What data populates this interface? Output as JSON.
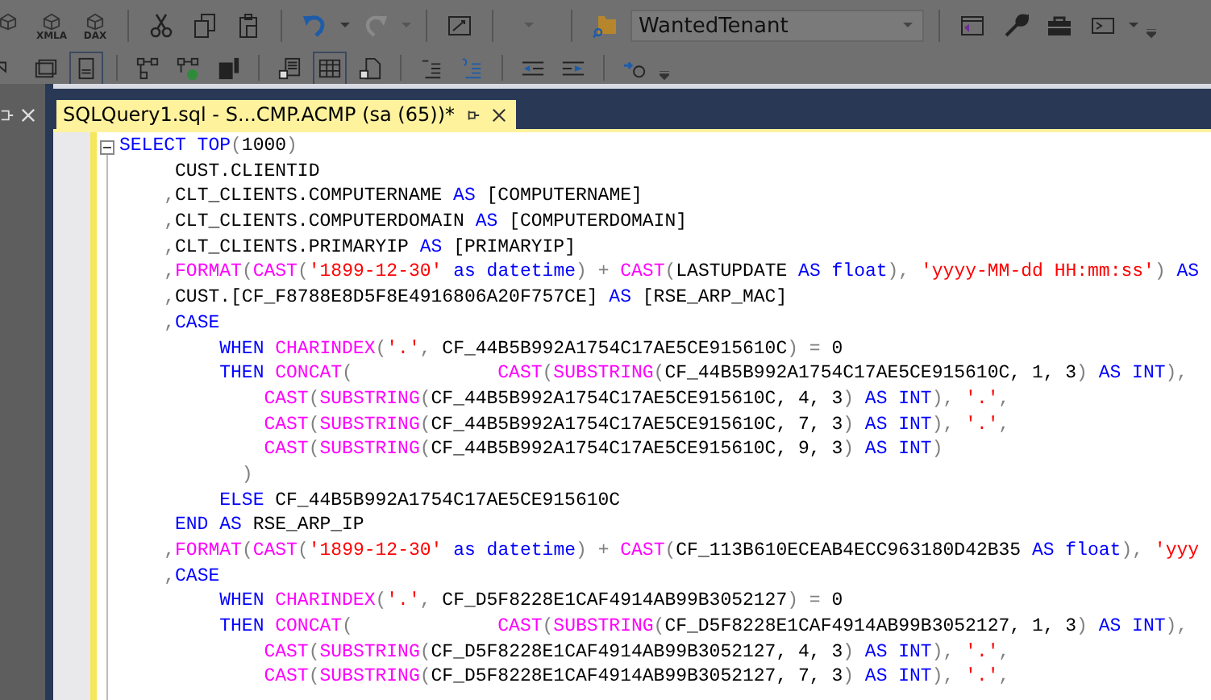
{
  "toolbar": {
    "icon_labels": [
      "XMLA",
      "DAX"
    ],
    "database_combo": {
      "value": "WantedTenant"
    }
  },
  "document_tab": {
    "title": "SQLQuery1.sql - S...CMP.ACMP (sa (65))*",
    "selected": true
  },
  "code_lines": [
    [
      {
        "kind": "kw",
        "text": "SELECT TOP"
      },
      {
        "kind": "op",
        "text": "("
      },
      {
        "kind": "txt",
        "text": "1000"
      },
      {
        "kind": "op",
        "text": ")"
      }
    ],
    [
      {
        "kind": "txt",
        "text": "     CUST.CLIENTID"
      }
    ],
    [
      {
        "kind": "op",
        "text": "    ,"
      },
      {
        "kind": "txt",
        "text": "CLT_CLIENTS.COMPUTERNAME"
      },
      {
        "kind": "kw",
        "text": " AS"
      },
      {
        "kind": "txt",
        "text": " [COMPUTERNAME]"
      }
    ],
    [
      {
        "kind": "op",
        "text": "    ,"
      },
      {
        "kind": "txt",
        "text": "CLT_CLIENTS.COMPUTERDOMAIN"
      },
      {
        "kind": "kw",
        "text": " AS"
      },
      {
        "kind": "txt",
        "text": " [COMPUTERDOMAIN]"
      }
    ],
    [
      {
        "kind": "op",
        "text": "    ,"
      },
      {
        "kind": "txt",
        "text": "CLT_CLIENTS.PRIMARYIP"
      },
      {
        "kind": "kw",
        "text": " AS"
      },
      {
        "kind": "txt",
        "text": " [PRIMARYIP]"
      }
    ],
    [
      {
        "kind": "op",
        "text": "    ,"
      },
      {
        "kind": "fn",
        "text": "FORMAT"
      },
      {
        "kind": "op",
        "text": "("
      },
      {
        "kind": "fn",
        "text": "CAST"
      },
      {
        "kind": "op",
        "text": "("
      },
      {
        "kind": "str",
        "text": "'1899-12-30'"
      },
      {
        "kind": "kw",
        "text": " as datetime"
      },
      {
        "kind": "op",
        "text": ") + "
      },
      {
        "kind": "fn",
        "text": "CAST"
      },
      {
        "kind": "op",
        "text": "("
      },
      {
        "kind": "txt",
        "text": "LASTUPDATE"
      },
      {
        "kind": "kw",
        "text": " AS float"
      },
      {
        "kind": "op",
        "text": "), "
      },
      {
        "kind": "str",
        "text": "'yyyy-MM-dd HH:mm:ss'"
      },
      {
        "kind": "op",
        "text": ")"
      },
      {
        "kind": "kw",
        "text": " AS"
      }
    ],
    [
      {
        "kind": "op",
        "text": "    ,"
      },
      {
        "kind": "txt",
        "text": "CUST.[CF_F8788E8D5F8E4916806A20F757CE]"
      },
      {
        "kind": "kw",
        "text": " AS"
      },
      {
        "kind": "txt",
        "text": " [RSE_ARP_MAC]"
      }
    ],
    [
      {
        "kind": "op",
        "text": "    ,"
      },
      {
        "kind": "kw",
        "text": "CASE"
      }
    ],
    [
      {
        "kind": "kw",
        "text": "         WHEN"
      },
      {
        "kind": "fn",
        "text": " CHARINDEX"
      },
      {
        "kind": "op",
        "text": "("
      },
      {
        "kind": "str",
        "text": "'.'"
      },
      {
        "kind": "op",
        "text": ", "
      },
      {
        "kind": "txt",
        "text": "CF_44B5B992A1754C17AE5CE915610C"
      },
      {
        "kind": "op",
        "text": ") = "
      },
      {
        "kind": "txt",
        "text": "0"
      }
    ],
    [
      {
        "kind": "kw",
        "text": "         THEN"
      },
      {
        "kind": "fn",
        "text": " CONCAT"
      },
      {
        "kind": "op",
        "text": "(             "
      },
      {
        "kind": "fn",
        "text": "CAST"
      },
      {
        "kind": "op",
        "text": "("
      },
      {
        "kind": "fn",
        "text": "SUBSTRING"
      },
      {
        "kind": "op",
        "text": "("
      },
      {
        "kind": "txt",
        "text": "CF_44B5B992A1754C17AE5CE915610C, 1, 3"
      },
      {
        "kind": "op",
        "text": ")"
      },
      {
        "kind": "kw",
        "text": " AS INT"
      },
      {
        "kind": "op",
        "text": "),"
      }
    ],
    [
      {
        "kind": "fn",
        "text": "             CAST"
      },
      {
        "kind": "op",
        "text": "("
      },
      {
        "kind": "fn",
        "text": "SUBSTRING"
      },
      {
        "kind": "op",
        "text": "("
      },
      {
        "kind": "txt",
        "text": "CF_44B5B992A1754C17AE5CE915610C, 4, 3"
      },
      {
        "kind": "op",
        "text": ")"
      },
      {
        "kind": "kw",
        "text": " AS INT"
      },
      {
        "kind": "op",
        "text": "), "
      },
      {
        "kind": "str",
        "text": "'.'"
      },
      {
        "kind": "op",
        "text": ","
      }
    ],
    [
      {
        "kind": "fn",
        "text": "             CAST"
      },
      {
        "kind": "op",
        "text": "("
      },
      {
        "kind": "fn",
        "text": "SUBSTRING"
      },
      {
        "kind": "op",
        "text": "("
      },
      {
        "kind": "txt",
        "text": "CF_44B5B992A1754C17AE5CE915610C, 7, 3"
      },
      {
        "kind": "op",
        "text": ")"
      },
      {
        "kind": "kw",
        "text": " AS INT"
      },
      {
        "kind": "op",
        "text": "), "
      },
      {
        "kind": "str",
        "text": "'.'"
      },
      {
        "kind": "op",
        "text": ","
      }
    ],
    [
      {
        "kind": "fn",
        "text": "             CAST"
      },
      {
        "kind": "op",
        "text": "("
      },
      {
        "kind": "fn",
        "text": "SUBSTRING"
      },
      {
        "kind": "op",
        "text": "("
      },
      {
        "kind": "txt",
        "text": "CF_44B5B992A1754C17AE5CE915610C, 9, 3"
      },
      {
        "kind": "op",
        "text": ")"
      },
      {
        "kind": "kw",
        "text": " AS INT"
      },
      {
        "kind": "op",
        "text": ")"
      }
    ],
    [
      {
        "kind": "op",
        "text": "           )"
      }
    ],
    [
      {
        "kind": "kw",
        "text": "         ELSE"
      },
      {
        "kind": "txt",
        "text": " CF_44B5B992A1754C17AE5CE915610C"
      }
    ],
    [
      {
        "kind": "kw",
        "text": "     END AS"
      },
      {
        "kind": "txt",
        "text": " RSE_ARP_IP"
      }
    ],
    [
      {
        "kind": "op",
        "text": "    ,"
      },
      {
        "kind": "fn",
        "text": "FORMAT"
      },
      {
        "kind": "op",
        "text": "("
      },
      {
        "kind": "fn",
        "text": "CAST"
      },
      {
        "kind": "op",
        "text": "("
      },
      {
        "kind": "str",
        "text": "'1899-12-30'"
      },
      {
        "kind": "kw",
        "text": " as datetime"
      },
      {
        "kind": "op",
        "text": ") + "
      },
      {
        "kind": "fn",
        "text": "CAST"
      },
      {
        "kind": "op",
        "text": "("
      },
      {
        "kind": "txt",
        "text": "CF_113B610ECEAB4ECC963180D42B35"
      },
      {
        "kind": "kw",
        "text": " AS float"
      },
      {
        "kind": "op",
        "text": "), "
      },
      {
        "kind": "str",
        "text": "'yyy"
      }
    ],
    [
      {
        "kind": "op",
        "text": "    ,"
      },
      {
        "kind": "kw",
        "text": "CASE"
      }
    ],
    [
      {
        "kind": "kw",
        "text": "         WHEN"
      },
      {
        "kind": "fn",
        "text": " CHARINDEX"
      },
      {
        "kind": "op",
        "text": "("
      },
      {
        "kind": "str",
        "text": "'.'"
      },
      {
        "kind": "op",
        "text": ", "
      },
      {
        "kind": "txt",
        "text": "CF_D5F8228E1CAF4914AB99B3052127"
      },
      {
        "kind": "op",
        "text": ") = "
      },
      {
        "kind": "txt",
        "text": "0"
      }
    ],
    [
      {
        "kind": "kw",
        "text": "         THEN"
      },
      {
        "kind": "fn",
        "text": " CONCAT"
      },
      {
        "kind": "op",
        "text": "(             "
      },
      {
        "kind": "fn",
        "text": "CAST"
      },
      {
        "kind": "op",
        "text": "("
      },
      {
        "kind": "fn",
        "text": "SUBSTRING"
      },
      {
        "kind": "op",
        "text": "("
      },
      {
        "kind": "txt",
        "text": "CF_D5F8228E1CAF4914AB99B3052127, 1, 3"
      },
      {
        "kind": "op",
        "text": ")"
      },
      {
        "kind": "kw",
        "text": " AS INT"
      },
      {
        "kind": "op",
        "text": "),"
      }
    ],
    [
      {
        "kind": "fn",
        "text": "             CAST"
      },
      {
        "kind": "op",
        "text": "("
      },
      {
        "kind": "fn",
        "text": "SUBSTRING"
      },
      {
        "kind": "op",
        "text": "("
      },
      {
        "kind": "txt",
        "text": "CF_D5F8228E1CAF4914AB99B3052127, 4, 3"
      },
      {
        "kind": "op",
        "text": ")"
      },
      {
        "kind": "kw",
        "text": " AS INT"
      },
      {
        "kind": "op",
        "text": "), "
      },
      {
        "kind": "str",
        "text": "'.'"
      },
      {
        "kind": "op",
        "text": ","
      }
    ],
    [
      {
        "kind": "fn",
        "text": "             CAST"
      },
      {
        "kind": "op",
        "text": "("
      },
      {
        "kind": "fn",
        "text": "SUBSTRING"
      },
      {
        "kind": "op",
        "text": "("
      },
      {
        "kind": "txt",
        "text": "CF_D5F8228E1CAF4914AB99B3052127, 7, 3"
      },
      {
        "kind": "op",
        "text": ")"
      },
      {
        "kind": "kw",
        "text": " AS INT"
      },
      {
        "kind": "op",
        "text": "), "
      },
      {
        "kind": "str",
        "text": "'.'"
      },
      {
        "kind": "op",
        "text": ","
      }
    ]
  ]
}
